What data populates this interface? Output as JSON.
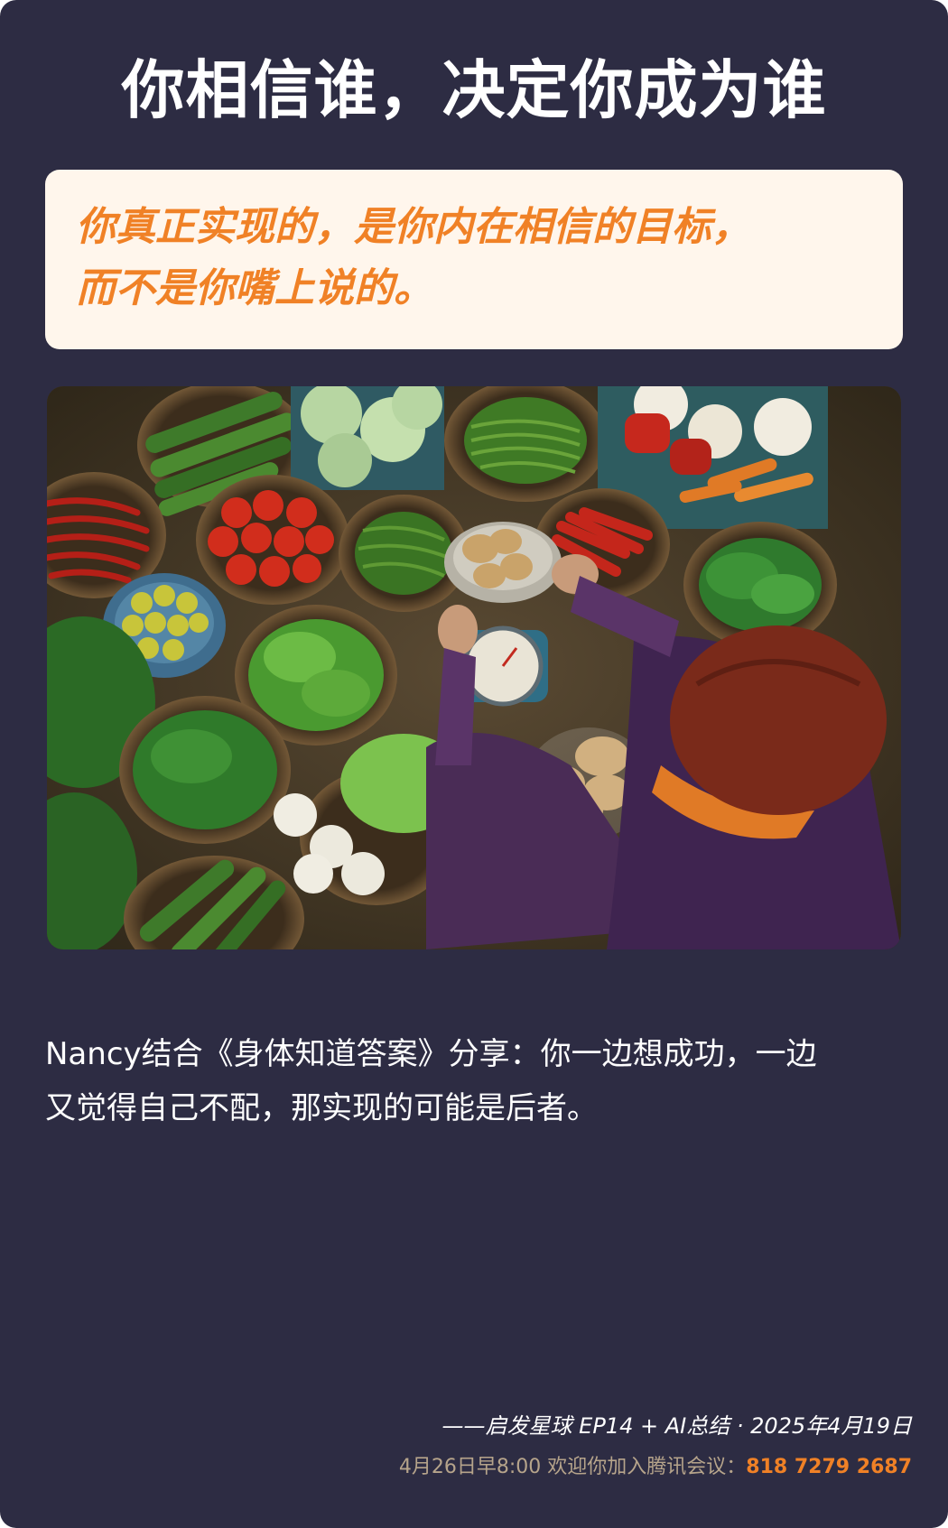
{
  "page": {
    "title": "你相信谁，决定你成为谁"
  },
  "quote": {
    "line1": "你真正实现的，是你内在相信的目标，",
    "line2": "而不是你嘴上说的。"
  },
  "photo": {
    "subject": "market-vegetable-vendor"
  },
  "body": {
    "line1": "Nancy结合《身体知道答案》分享：你一边想成功，一边",
    "line2": "又觉得自己不配，那实现的可能是后者。"
  },
  "footer": {
    "source": "——启发星球 EP14 + AI总结 · 2025年4月19日",
    "invite_label": "4月26日早8:00 欢迎你加入腾讯会议：",
    "meeting_number": "818 7279 2687"
  },
  "colors": {
    "background": "#2d2c43",
    "accent": "#f08126",
    "quote_bg": "#fff6ec",
    "muted": "#b6a48b"
  }
}
